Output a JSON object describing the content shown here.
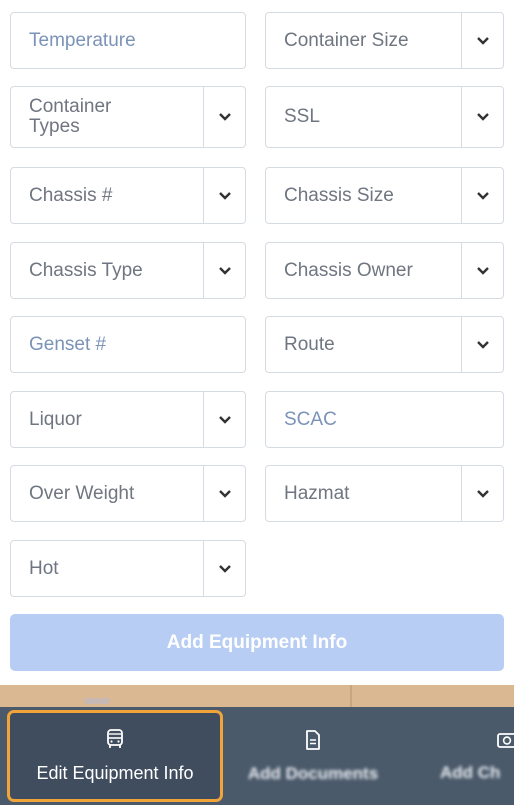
{
  "fields": [
    {
      "id": "temperature",
      "label": "Temperature",
      "placeholder": true,
      "dropdown": false
    },
    {
      "id": "container-size",
      "label": "Container Size",
      "placeholder": false,
      "dropdown": true
    },
    {
      "id": "container-types",
      "label": "Container Types",
      "placeholder": false,
      "dropdown": true
    },
    {
      "id": "ssl",
      "label": "SSL",
      "placeholder": false,
      "dropdown": true
    },
    {
      "id": "chassis-number",
      "label": "Chassis #",
      "placeholder": false,
      "dropdown": true
    },
    {
      "id": "chassis-size",
      "label": "Chassis Size",
      "placeholder": false,
      "dropdown": true
    },
    {
      "id": "chassis-type",
      "label": "Chassis Type",
      "placeholder": false,
      "dropdown": true
    },
    {
      "id": "chassis-owner",
      "label": "Chassis Owner",
      "placeholder": false,
      "dropdown": true
    },
    {
      "id": "genset-number",
      "label": "Genset #",
      "placeholder": true,
      "dropdown": false
    },
    {
      "id": "route",
      "label": "Route",
      "placeholder": false,
      "dropdown": true
    },
    {
      "id": "liquor",
      "label": "Liquor",
      "placeholder": false,
      "dropdown": true
    },
    {
      "id": "scac",
      "label": "SCAC",
      "placeholder": true,
      "dropdown": false
    },
    {
      "id": "over-weight",
      "label": "Over Weight",
      "placeholder": false,
      "dropdown": true
    },
    {
      "id": "hazmat",
      "label": "Hazmat",
      "placeholder": false,
      "dropdown": true
    },
    {
      "id": "hot",
      "label": "Hot",
      "placeholder": false,
      "dropdown": true
    }
  ],
  "add_button": {
    "label": "Add Equipment Info"
  },
  "bottom_tabs": [
    {
      "label": "Edit Equipment Info",
      "icon": "bus-icon",
      "active": true
    },
    {
      "label": "Add Documents",
      "icon": "document-icon",
      "active": false
    },
    {
      "label": "Add Ch",
      "icon": "camera-icon",
      "active": false
    }
  ],
  "colors": {
    "field_border": "#d5dbe3",
    "placeholder_text": "#7b93b8",
    "value_text": "#6f7681",
    "button_bg": "#b8cdf3",
    "bottom_bar_bg": "#4b5a6b",
    "active_tab_border": "#f0a43a",
    "strip_bg": "#d9b892"
  }
}
